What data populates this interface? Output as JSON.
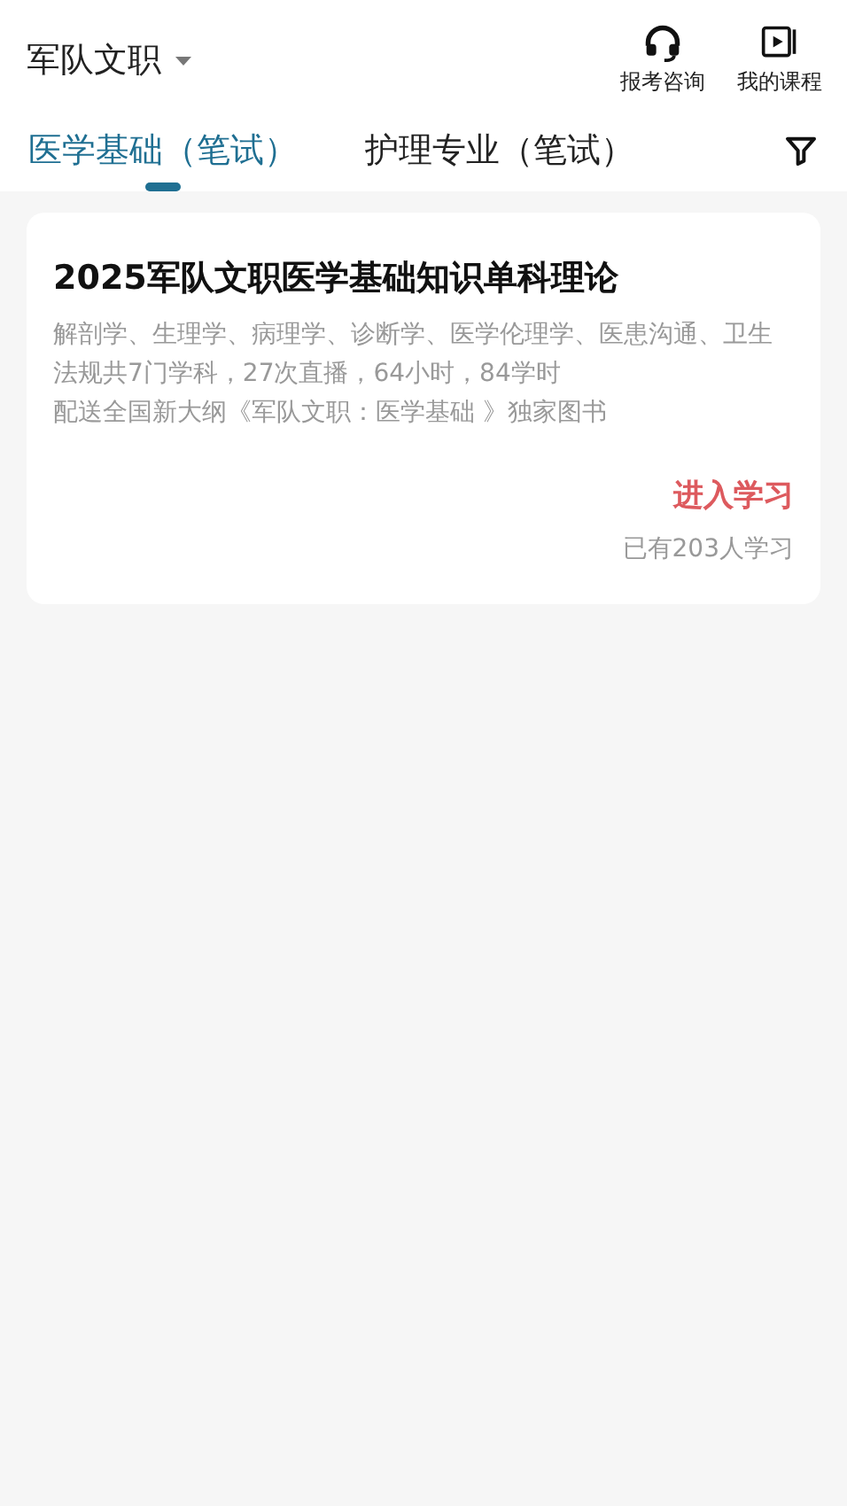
{
  "header": {
    "category": "军队文职",
    "actions": [
      {
        "kind": "headset",
        "label": "报考咨询"
      },
      {
        "kind": "play",
        "label": "我的课程"
      }
    ]
  },
  "tabs": [
    {
      "label": "医学基础（笔试）",
      "selected": true
    },
    {
      "label": "护理专业（笔试）",
      "selected": false
    }
  ],
  "courses": [
    {
      "title": "2025军队文职医学基础知识单科理论",
      "description": [
        "解剖学、生理学、病理学、诊断学、医学伦理学、医患沟通、卫生法规共7门学科，27次直播，64小时，84学时",
        "配送全国新大纲《军队文职：医学基础 》独家图书"
      ],
      "action": "进入学习",
      "learners": "已有203人学习"
    }
  ]
}
